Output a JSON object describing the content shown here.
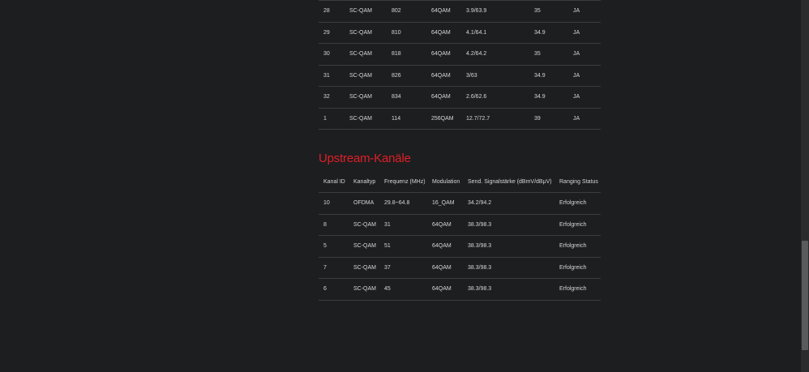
{
  "downstream": {
    "rows": [
      {
        "kanal_id": "28",
        "kanaltyp": "SC-QAM",
        "frequenz": "802",
        "modulation": "64QAM",
        "snr": "3.9/63.9",
        "signal": "35",
        "locked": "JA"
      },
      {
        "kanal_id": "29",
        "kanaltyp": "SC-QAM",
        "frequenz": "810",
        "modulation": "64QAM",
        "snr": "4.1/64.1",
        "signal": "34.9",
        "locked": "JA"
      },
      {
        "kanal_id": "30",
        "kanaltyp": "SC-QAM",
        "frequenz": "818",
        "modulation": "64QAM",
        "snr": "4.2/64.2",
        "signal": "35",
        "locked": "JA"
      },
      {
        "kanal_id": "31",
        "kanaltyp": "SC-QAM",
        "frequenz": "826",
        "modulation": "64QAM",
        "snr": "3/63",
        "signal": "34.9",
        "locked": "JA"
      },
      {
        "kanal_id": "32",
        "kanaltyp": "SC-QAM",
        "frequenz": "834",
        "modulation": "64QAM",
        "snr": "2.6/62.6",
        "signal": "34.9",
        "locked": "JA"
      },
      {
        "kanal_id": "1",
        "kanaltyp": "SC-QAM",
        "frequenz": "114",
        "modulation": "256QAM",
        "snr": "12.7/72.7",
        "signal": "39",
        "locked": "JA"
      }
    ]
  },
  "upstream": {
    "title": "Upstream-Kanäle",
    "headers": {
      "kanal_id": "Kanal ID",
      "kanaltyp": "Kanaltyp",
      "frequenz": "Frequenz (MHz)",
      "modulation": "Modulation",
      "signal": "Send. Signalstärke (dBmV/dBμV)",
      "ranging": "Ranging Status"
    },
    "rows": [
      {
        "kanal_id": "10",
        "kanaltyp": "OFDMA",
        "frequenz": "29.8~64.8",
        "modulation": "16_QAM",
        "signal": "34.2/94.2",
        "ranging": "Erfolgreich"
      },
      {
        "kanal_id": "8",
        "kanaltyp": "SC-QAM",
        "frequenz": "31",
        "modulation": "64QAM",
        "signal": "38.3/98.3",
        "ranging": "Erfolgreich"
      },
      {
        "kanal_id": "5",
        "kanaltyp": "SC-QAM",
        "frequenz": "51",
        "modulation": "64QAM",
        "signal": "38.3/98.3",
        "ranging": "Erfolgreich"
      },
      {
        "kanal_id": "7",
        "kanaltyp": "SC-QAM",
        "frequenz": "37",
        "modulation": "64QAM",
        "signal": "38.3/98.3",
        "ranging": "Erfolgreich"
      },
      {
        "kanal_id": "6",
        "kanaltyp": "SC-QAM",
        "frequenz": "45",
        "modulation": "64QAM",
        "signal": "38.3/98.3",
        "ranging": "Erfolgreich"
      }
    ]
  },
  "colors": {
    "background": "#1d1e20",
    "accent": "#e01f26",
    "text": "#d6d6d6",
    "divider": "#3b3c3e"
  }
}
